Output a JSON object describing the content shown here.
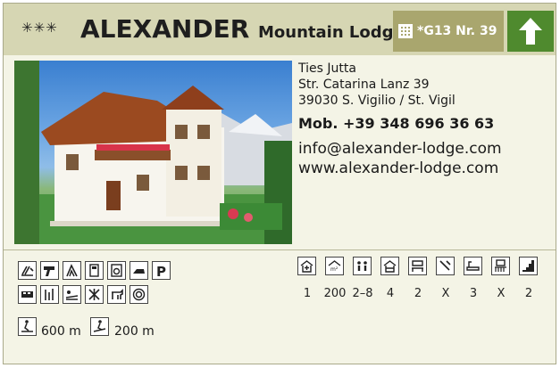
{
  "header": {
    "stars": "✳✳✳",
    "title": "ALEXANDER",
    "subtitle": "Mountain Lodge",
    "code": "*G13 Nr. 39"
  },
  "contact": {
    "name": "Ties Jutta",
    "street": "Str. Catarina Lanz 39",
    "city": "39030 S. Vigilio / St. Vigil",
    "mobile": "Mob. +39 348 696 36 63",
    "email": "info@alexander-lodge.com",
    "website": "www.alexander-lodge.com"
  },
  "amenities_row1": [
    "ski-storage-icon",
    "hair-dryer-icon",
    "sauna-icon",
    "safe-icon",
    "washing-machine-icon",
    "iron-icon",
    "parking-icon"
  ],
  "amenities_row2": [
    "bus-icon",
    "garden-icon",
    "sunbathing-icon",
    "playground-icon",
    "pets-icon",
    "satellite-tv-icon"
  ],
  "facts": [
    {
      "icon": "type-icon",
      "value": "1"
    },
    {
      "icon": "size-icon",
      "value": "200"
    },
    {
      "icon": "persons-icon",
      "value": "2–8"
    },
    {
      "icon": "rooms-icon",
      "value": "4"
    },
    {
      "icon": "bedrooms-icon",
      "value": "2"
    },
    {
      "icon": "kitchen-icon",
      "value": "X"
    },
    {
      "icon": "bathroom-icon",
      "value": "3"
    },
    {
      "icon": "balcony-icon",
      "value": "X"
    },
    {
      "icon": "floor-icon",
      "value": "2"
    }
  ],
  "distances": [
    {
      "icon": "ski-lift-distance-icon",
      "value": "600 m"
    },
    {
      "icon": "ski-slope-distance-icon",
      "value": "200 m"
    }
  ]
}
